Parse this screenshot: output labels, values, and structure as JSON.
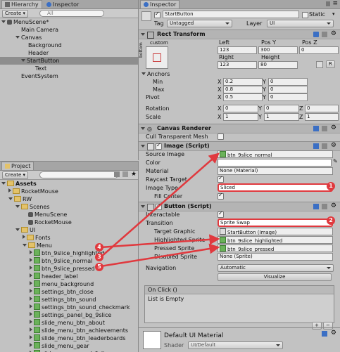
{
  "hierarchy": {
    "tabs": [
      "Hierarchy",
      "Inspector"
    ],
    "create_label": "Create",
    "search_placeholder": "All",
    "scene_name": "MenuScene*",
    "items": [
      "Main Camera",
      "Canvas",
      "Background",
      "Header",
      "StartButton",
      "Text",
      "EventSystem"
    ]
  },
  "project": {
    "tab": "Project",
    "create_label": "Create",
    "root": "Assets",
    "items": [
      "RocketMouse",
      "RW",
      "Scenes",
      "MenuScene",
      "RocketMouse",
      "UI",
      "Fonts",
      "Menu",
      "btn_9slice_highlighted",
      "btn_9slice_normal",
      "btn_9slice_pressed",
      "header_label",
      "menu_background",
      "settings_btn_close",
      "settings_btn_sound",
      "settings_btn_sound_checkmark",
      "settings_panel_bg_9slice",
      "slide_menu_btn_about",
      "slide_menu_btn_achievements",
      "slide_menu_btn_leaderboards",
      "slide_menu_gear",
      "slide_menu_panel_9slice"
    ]
  },
  "inspector": {
    "tab": "Inspector",
    "object_name": "StartButton",
    "static_label": "Static",
    "tag_label": "Tag",
    "tag_value": "Untagged",
    "layer_label": "Layer",
    "layer_value": "UI",
    "rect_transform": {
      "title": "Rect Transform",
      "anchor_preset": "custom",
      "anchor_side": "bottom",
      "col_left": "Left",
      "col_posy": "Pos Y",
      "col_posz": "Pos Z",
      "left": "123",
      "posy": "300",
      "posz": "0",
      "col_right": "Right",
      "col_height": "Height",
      "right": "123",
      "height": "80",
      "r_label": "R",
      "anchors_label": "Anchors",
      "min_label": "Min",
      "max_label": "Max",
      "min_x": "0.2",
      "min_y": "0",
      "max_x": "0.8",
      "max_y": "0",
      "pivot_label": "Pivot",
      "pivot_x": "0.5",
      "pivot_y": "0",
      "rotation_label": "Rotation",
      "rot_x": "0",
      "rot_y": "0",
      "rot_z": "0",
      "scale_label": "Scale",
      "scale_x": "1",
      "scale_y": "1",
      "scale_z": "1",
      "x": "X",
      "y": "Y",
      "z": "Z"
    },
    "canvas_renderer": {
      "title": "Canvas Renderer",
      "cull_label": "Cull Transparent Mesh"
    },
    "image": {
      "title": "Image (Script)",
      "source_label": "Source Image",
      "source_value": "btn_9slice_normal",
      "color_label": "Color",
      "material_label": "Material",
      "material_value": "None (Material)",
      "raycast_label": "Raycast Target",
      "type_label": "Image Type",
      "type_value": "Sliced",
      "fill_label": "Fill Center"
    },
    "button": {
      "title": "Button (Script)",
      "interactable_label": "Interactable",
      "transition_label": "Transition",
      "transition_value": "Sprite Swap",
      "target_label": "Target Graphic",
      "target_value": "StartButton (Image)",
      "highlighted_label": "Highlighted Sprite",
      "highlighted_value": "btn_9slice_highlighted",
      "pressed_label": "Pressed Sprite",
      "pressed_value": "btn_9slice_pressed",
      "disabled_label": "Disabled Sprite",
      "disabled_value": "None (Sprite)",
      "navigation_label": "Navigation",
      "navigation_value": "Automatic",
      "visualize_label": "Visualize",
      "onclick_label": "On Click ()",
      "list_empty": "List is Empty",
      "plus": "+",
      "minus": "−"
    },
    "material": {
      "name": "Default UI Material",
      "shader_label": "Shader",
      "shader_value": "UI/Default"
    }
  },
  "callouts": [
    "1",
    "2",
    "3",
    "4",
    "5"
  ],
  "colors": {
    "accent": "#e0393e",
    "selected_row": "#8fa9d6"
  }
}
